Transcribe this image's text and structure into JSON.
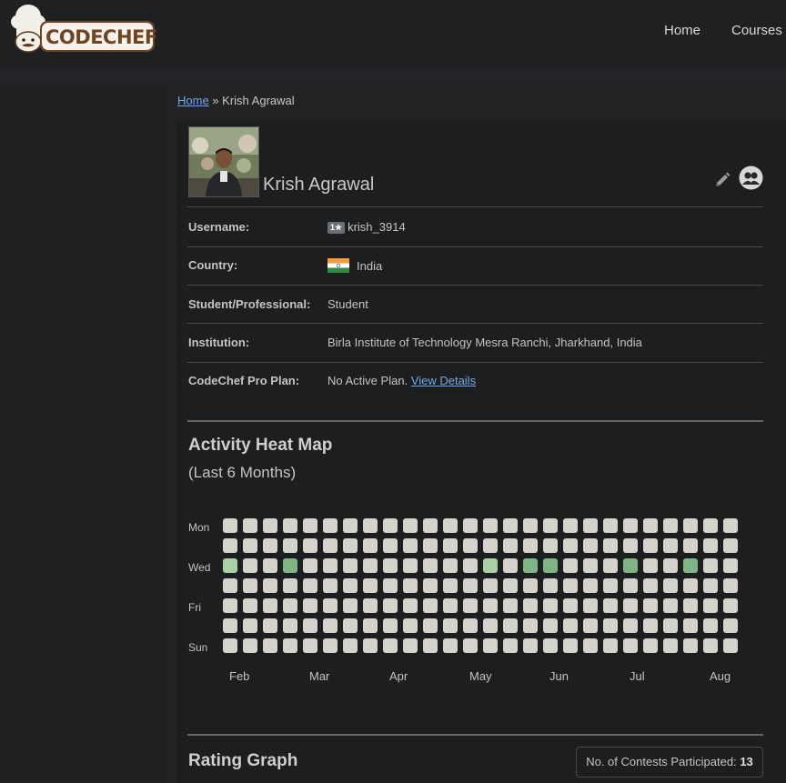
{
  "brand": {
    "logo_text": "CODECHEF"
  },
  "nav": {
    "home": "Home",
    "courses": "Courses"
  },
  "breadcrumb": {
    "home": "Home",
    "separator": "»",
    "current": "Krish Agrawal"
  },
  "profile": {
    "name": "Krish Agrawal",
    "rows": [
      {
        "label": "Username:",
        "value": "krish_3914",
        "badge": "1★"
      },
      {
        "label": "Country:",
        "value": "India"
      },
      {
        "label": "Student/Professional:",
        "value": "Student"
      },
      {
        "label": "Institution:",
        "value": "Birla Institute of Technology Mesra Ranchi, Jharkhand, India"
      },
      {
        "label": "CodeChef Pro Plan:",
        "value": "No Active Plan.",
        "link": "View Details"
      }
    ]
  },
  "heatmap": {
    "title": "Activity Heat Map",
    "subtitle": "(Last 6 Months)",
    "day_labels": [
      "Mon",
      "Wed",
      "Fri",
      "Sun"
    ],
    "month_labels": [
      "Feb",
      "Mar",
      "Apr",
      "May",
      "Jun",
      "Jul",
      "Aug"
    ],
    "active_cells": [
      {
        "week": 0,
        "day": 2,
        "level": 1
      },
      {
        "week": 3,
        "day": 2,
        "level": 2
      },
      {
        "week": 13,
        "day": 2,
        "level": 1
      },
      {
        "week": 15,
        "day": 2,
        "level": 2
      },
      {
        "week": 16,
        "day": 2,
        "level": 2
      },
      {
        "week": 20,
        "day": 2,
        "level": 2
      },
      {
        "week": 23,
        "day": 2,
        "level": 2
      }
    ],
    "colors": {
      "empty": "#d6d3cd",
      "level1": "#a9d0a4",
      "level2": "#7fb584"
    }
  },
  "rating": {
    "title": "Rating Graph",
    "contests_label": "No. of Contests Participated:",
    "contests_count": "13"
  }
}
